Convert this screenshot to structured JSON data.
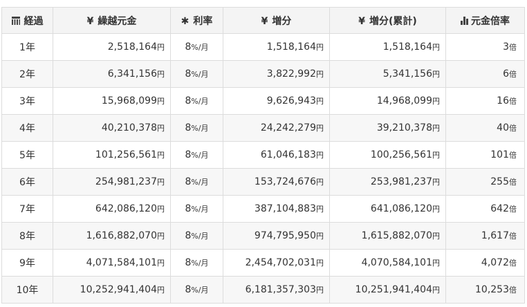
{
  "header": {
    "col_year": "経過",
    "col_principal": "繰越元金",
    "col_rate": "利率",
    "col_increase": "増分",
    "col_cumulative": "増分(累計)",
    "col_multiple": "元金倍率",
    "yen_symbol": "¥",
    "rate_symbol": "✱"
  },
  "units": {
    "yen": "円",
    "per_month": "%/月",
    "times": "倍"
  },
  "rows": [
    {
      "year": "1年",
      "principal": "2,518,164",
      "rate": "8",
      "increase": "1,518,164",
      "cumulative": "1,518,164",
      "multiple": "3"
    },
    {
      "year": "2年",
      "principal": "6,341,156",
      "rate": "8",
      "increase": "3,822,992",
      "cumulative": "5,341,156",
      "multiple": "6"
    },
    {
      "year": "3年",
      "principal": "15,968,099",
      "rate": "8",
      "increase": "9,626,943",
      "cumulative": "14,968,099",
      "multiple": "16"
    },
    {
      "year": "4年",
      "principal": "40,210,378",
      "rate": "8",
      "increase": "24,242,279",
      "cumulative": "39,210,378",
      "multiple": "40"
    },
    {
      "year": "5年",
      "principal": "101,256,561",
      "rate": "8",
      "increase": "61,046,183",
      "cumulative": "100,256,561",
      "multiple": "101"
    },
    {
      "year": "6年",
      "principal": "254,981,237",
      "rate": "8",
      "increase": "153,724,676",
      "cumulative": "253,981,237",
      "multiple": "255"
    },
    {
      "year": "7年",
      "principal": "642,086,120",
      "rate": "8",
      "increase": "387,104,883",
      "cumulative": "641,086,120",
      "multiple": "642"
    },
    {
      "year": "8年",
      "principal": "1,616,882,070",
      "rate": "8",
      "increase": "974,795,950",
      "cumulative": "1,615,882,070",
      "multiple": "1,617"
    },
    {
      "year": "9年",
      "principal": "4,071,584,101",
      "rate": "8",
      "increase": "2,454,702,031",
      "cumulative": "4,070,584,101",
      "multiple": "4,072"
    },
    {
      "year": "10年",
      "principal": "10,252,941,404",
      "rate": "8",
      "increase": "6,181,357,303",
      "cumulative": "10,251,941,404",
      "multiple": "10,253"
    }
  ],
  "icons": {
    "year": "calendar-icon",
    "principal": "yen-icon",
    "rate": "asterisk-icon",
    "increase": "yen-icon",
    "cumulative": "yen-icon",
    "multiple": "bar-chart-icon"
  },
  "colors": {
    "header_bg": "#f4f4f4",
    "alt_row_bg": "#f7f7f7",
    "border": "#dcdcdc",
    "text": "#333333"
  }
}
